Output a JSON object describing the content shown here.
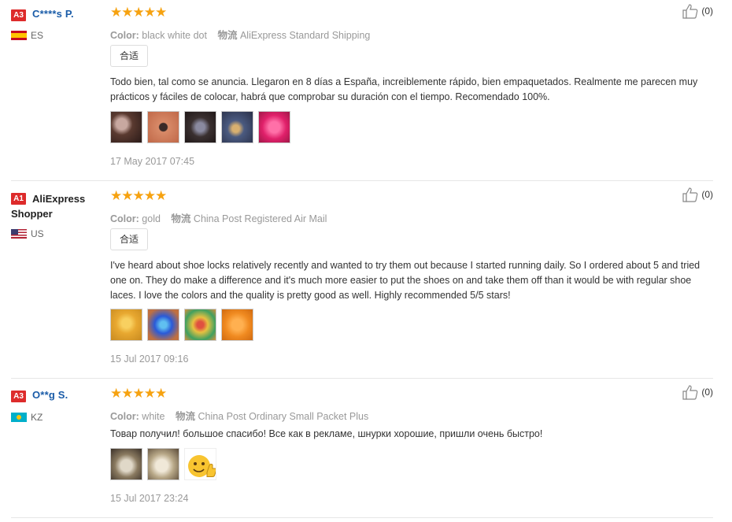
{
  "reviews": [
    {
      "level": "A3",
      "name": "C****s P.",
      "country": "ES",
      "flag": "flag-es",
      "stars": "★★★★★",
      "color_label": "Color:",
      "color_value": "black white dot",
      "ship_label": "物流",
      "ship_value": "AliExpress Standard Shipping",
      "tag": "合适",
      "text": "Todo bien, tal como se anuncia. Llegaron en 8 días a España, increiblemente rápido, bien empaquetados. Realmente me parecen muy prácticos y fáciles de colocar, habrá que comprobar su duración con el tiempo. Recomendado 100%.",
      "photos": [
        "#6b4a3a",
        "#c47a5a",
        "#4a4040",
        "#5a6a88",
        "#e23a7a"
      ],
      "date": "17 May 2017 07:45",
      "helpful": "(0)"
    },
    {
      "level": "A1",
      "name": "AliExpress Shopper",
      "country": "US",
      "flag": "flag-us",
      "stars": "★★★★★",
      "color_label": "Color:",
      "color_value": "gold",
      "ship_label": "物流",
      "ship_value": "China Post Registered Air Mail",
      "tag": "合适",
      "text": "I've heard about shoe locks relatively recently and wanted to try them out because I started running daily. So I ordered about 5 and tried one on. They do make a difference and it's much more easier to put the shoes on and take them off than it would be with regular shoe laces. I love the colors and the quality is pretty good as well. Highly recommended 5/5 stars!",
      "photos": [
        "#e8b23a",
        "#3a6ad0",
        "#d8a040",
        "#f0902a"
      ],
      "date": "15 Jul 2017 09:16",
      "helpful": "(0)"
    },
    {
      "level": "A3",
      "name": "O**g S.",
      "country": "KZ",
      "flag": "flag-kz",
      "stars": "★★★★★",
      "color_label": "Color:",
      "color_value": "white",
      "ship_label": "物流",
      "ship_value": "China Post Ordinary Small Packet Plus",
      "text": "Товар получил! большое спасибо! Все как в рекламе, шнурки хорошие, пришли очень быстро!",
      "photos": [
        "#9a8a70",
        "#c8b898",
        "#f5c030"
      ],
      "date": "15 Jul 2017 23:24",
      "helpful": "(0)"
    }
  ]
}
